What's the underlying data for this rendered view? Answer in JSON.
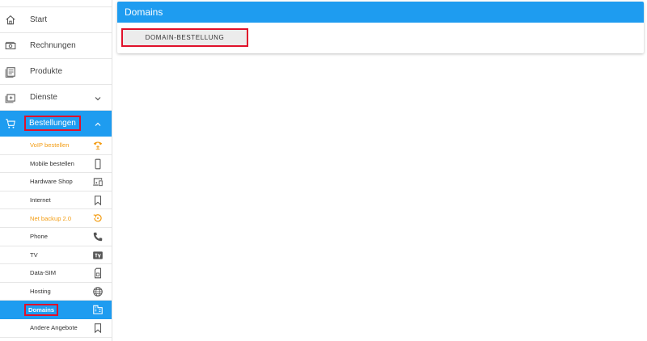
{
  "sidebar": {
    "items": [
      {
        "label": "Start",
        "icon": "home-icon"
      },
      {
        "label": "Rechnungen",
        "icon": "money-icon"
      },
      {
        "label": "Produkte",
        "icon": "document-icon"
      },
      {
        "label": "Dienste",
        "icon": "add-box-icon"
      },
      {
        "label": "Bestellungen",
        "icon": "cart-icon"
      }
    ],
    "sub_items": [
      {
        "label": "VoIP bestellen",
        "icon": "voip-phone-icon"
      },
      {
        "label": "Mobile bestellen",
        "icon": "mobile-icon"
      },
      {
        "label": "Hardware Shop",
        "icon": "devices-icon"
      },
      {
        "label": "Internet",
        "icon": "bookmark-icon"
      },
      {
        "label": "Net backup 2.0",
        "icon": "backup-restore-icon"
      },
      {
        "label": "Phone",
        "icon": "phone-icon"
      },
      {
        "label": "TV",
        "icon": "tv-icon"
      },
      {
        "label": "Data-SIM",
        "icon": "sim-card-icon"
      },
      {
        "label": "Hosting",
        "icon": "globe-icon"
      },
      {
        "label": "Domains",
        "icon": "domain-building-icon"
      },
      {
        "label": "Andere Angebote",
        "icon": "bookmark-icon"
      }
    ]
  },
  "panel": {
    "title": "Domains",
    "button_label": "DOMAIN-BESTELLUNG"
  },
  "colors": {
    "primary": "#1e9cf0",
    "highlight": "#e0112b",
    "orange": "#f39c12"
  }
}
